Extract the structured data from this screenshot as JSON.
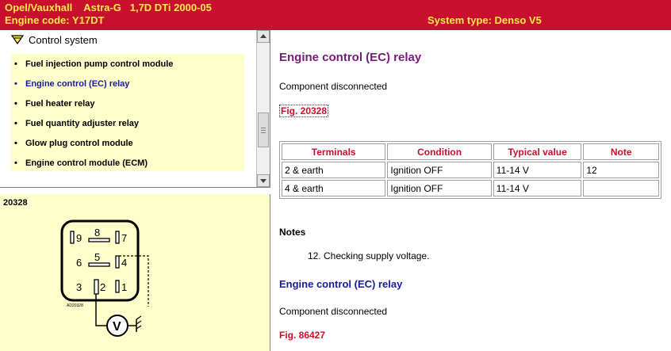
{
  "header": {
    "vehicle": "Opel/Vauxhall    Astra-G   1,7D DTi 2000-05",
    "engine_code": "Engine code: Y17DT",
    "system_type": "System type: Denso V5",
    "background_color": "#c8102e",
    "text_color": "#ffe94a"
  },
  "tree": {
    "header_label": "Control system",
    "header_icon": "chevron-down-icon",
    "items": [
      {
        "label": "Fuel injection pump control module"
      },
      {
        "label": "Engine control (EC) relay",
        "selected": true
      },
      {
        "label": "Fuel heater relay"
      },
      {
        "label": "Fuel quantity adjuster relay"
      },
      {
        "label": "Glow plug control module"
      },
      {
        "label": "Engine control module (ECM)"
      }
    ]
  },
  "figure": {
    "number": "20328",
    "caption_code": "AD20328",
    "pins": [
      "9",
      "8",
      "7",
      "6",
      "5",
      "4",
      "3",
      "2",
      "1"
    ],
    "meter_label": "V"
  },
  "content": {
    "title": "Engine control (EC) relay",
    "status": "Component disconnected",
    "fig_link": "Fig. 20328",
    "table": {
      "headers": [
        "Terminals",
        "Condition",
        "Typical value",
        "Note"
      ],
      "rows": [
        [
          "2 & earth",
          "Ignition OFF",
          "11-14 V",
          "12"
        ],
        [
          "4 & earth",
          "Ignition OFF",
          "11-14 V",
          ""
        ]
      ]
    },
    "notes_heading": "Notes",
    "notes": [
      "12. Checking supply voltage."
    ],
    "title2": "Engine control (EC) relay",
    "status2": "Component disconnected",
    "fig_link2": "Fig. 86427"
  }
}
